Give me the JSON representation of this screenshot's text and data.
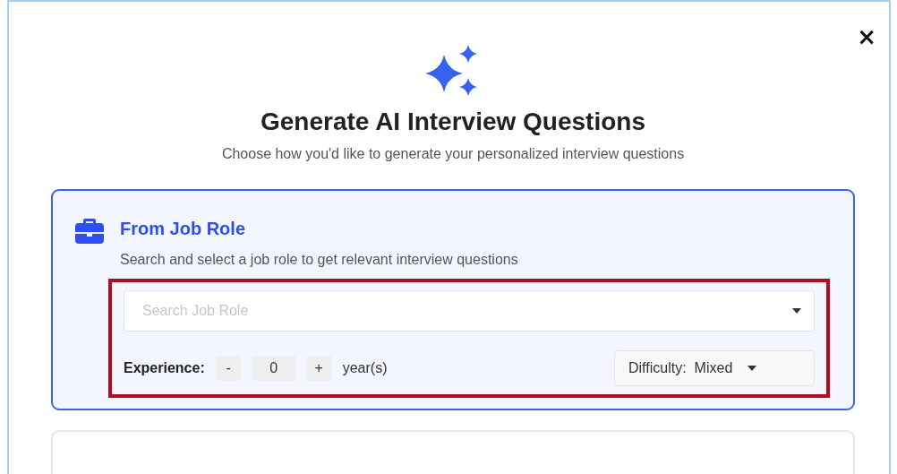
{
  "dialog": {
    "close": "×",
    "title": "Generate AI Interview Questions",
    "subtitle": "Choose how you'd like to generate your personalized interview questions"
  },
  "options": [
    {
      "kind": "job_role",
      "selected": true,
      "title": "From Job Role",
      "description": "Search and select a job role to get relevant interview questions",
      "highlighted": true,
      "search": {
        "placeholder": "Search Job Role"
      },
      "experience": {
        "label": "Experience:",
        "decrement": "-",
        "value": "0",
        "increment": "+",
        "unit": "year(s)"
      },
      "difficulty": {
        "label": "Difficulty:",
        "value": "Mixed"
      }
    },
    {
      "kind": "blank",
      "selected": false
    }
  ]
}
